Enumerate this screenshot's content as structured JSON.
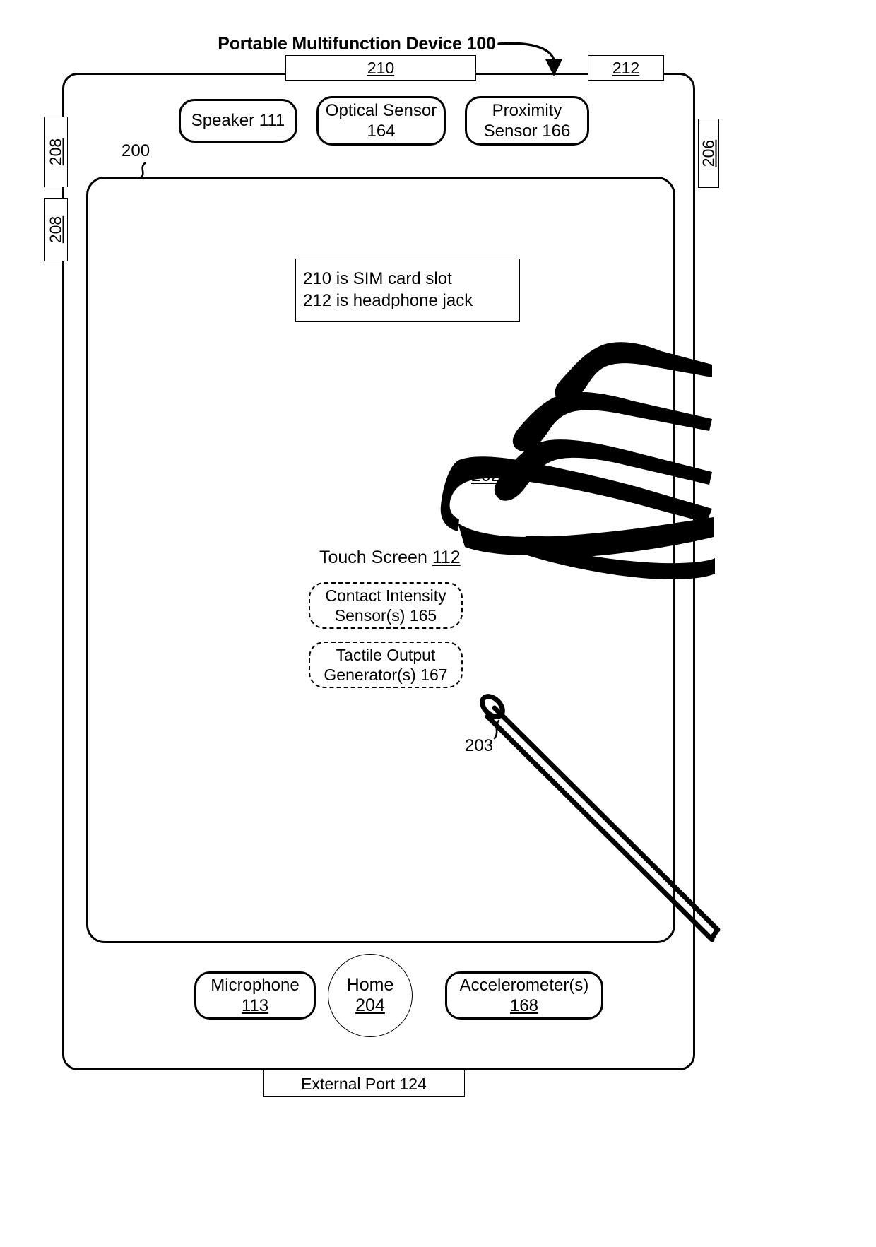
{
  "figure": {
    "title": "Portable Multifunction Device 100"
  },
  "ports": {
    "sim_slot_ref": "210",
    "headphone_jack_ref": "212",
    "external_port": "External Port 124"
  },
  "side_buttons": [
    {
      "name": "push-button-upper",
      "ref": "208"
    },
    {
      "name": "push-button-lower",
      "ref": "208"
    },
    {
      "name": "volume-button",
      "ref": "206"
    }
  ],
  "components": {
    "speaker": {
      "line1": "Speaker 111"
    },
    "optical_sensor": {
      "line1": "Optical Sensor",
      "line2": "164"
    },
    "proximity_sensor": {
      "line1": "Proximity",
      "line2": "Sensor 166"
    },
    "microphone": {
      "line1": "Microphone",
      "line2": "113"
    },
    "accelerometer": {
      "line1": "Accelerometer(s)",
      "line2": "168"
    },
    "home_button": {
      "line1": "Home",
      "line2": "204"
    },
    "contact_intensity_sensor": {
      "line1": "Contact Intensity",
      "line2": "Sensor(s) 165"
    },
    "tactile_output_generator": {
      "line1": "Tactile Output",
      "line2": "Generator(s) 167"
    }
  },
  "touch_screen": {
    "label": "Touch Screen 112",
    "label_text": "Touch Screen ",
    "label_ref": "112"
  },
  "legend_note": {
    "line1": "210 is SIM card slot",
    "line2": "212 is headphone jack"
  },
  "reference_labels": {
    "device_outline": "200",
    "finger_contact": "202",
    "stylus": "203"
  },
  "colors": {
    "ink": "#000000",
    "paper": "#ffffff"
  }
}
